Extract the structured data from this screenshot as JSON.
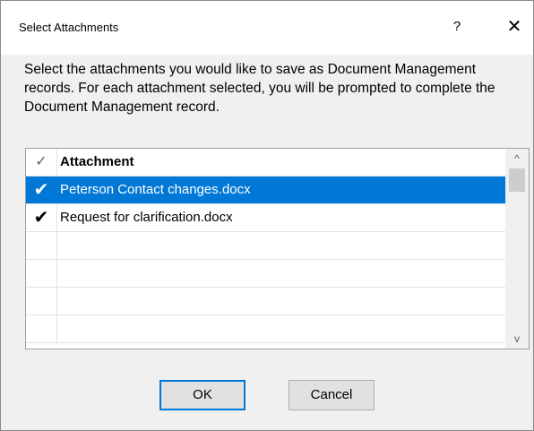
{
  "dialog": {
    "title": "Select Attachments",
    "help_glyph": "?",
    "close_glyph": "✕",
    "description": "Select the attachments you would like to save as Document Management records. For each attachment selected, you will be prompted to complete the Document Management record."
  },
  "grid": {
    "header": {
      "check_glyph": "✓",
      "column_label": "Attachment"
    },
    "rows": [
      {
        "checked": true,
        "check_glyph": "✔",
        "name": "Peterson Contact changes.docx",
        "selected": true
      },
      {
        "checked": true,
        "check_glyph": "✔",
        "name": "Request for clarification.docx",
        "selected": false
      }
    ],
    "scroll_up_glyph": "^",
    "scroll_down_glyph": "v"
  },
  "buttons": {
    "ok": "OK",
    "cancel": "Cancel"
  },
  "colors": {
    "selection": "#0078d7",
    "dialog_bg": "#f0f0f0"
  },
  "icons": [
    "help-icon",
    "close-icon",
    "checkmark-icon",
    "scroll-up-arrow-icon",
    "scroll-down-arrow-icon"
  ]
}
